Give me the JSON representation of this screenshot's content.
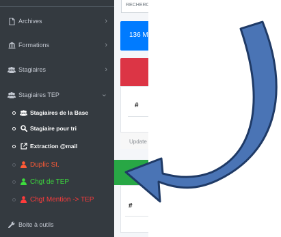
{
  "sidebar": {
    "items": [
      {
        "label": "Archives",
        "icon": "file-icon"
      },
      {
        "label": "Formations",
        "icon": "building-icon"
      },
      {
        "label": "Stagiaires",
        "icon": "users-icon"
      },
      {
        "label": "Stagiaires TEP",
        "icon": "users-icon"
      }
    ],
    "subitems": [
      {
        "label": "Stagiaires de la Base",
        "icon": "users-icon"
      },
      {
        "label": "Stagiaire pour tri",
        "icon": "search-icon"
      },
      {
        "label": "Extraction @mail",
        "icon": "external-link-icon"
      },
      {
        "label": "Duplic St.",
        "icon": "user-icon",
        "color": "#ff5a36"
      },
      {
        "label": "Chgt de TEP",
        "icon": "user-icon",
        "color": "#3ddc3d"
      },
      {
        "label": "Chgt Mention -> TEP",
        "icon": "user-icon",
        "color": "#ff3b3b"
      }
    ],
    "tools": {
      "label": "Boite à outils",
      "icon": "wrench-icon"
    }
  },
  "main": {
    "search_placeholder": "RECHERCHER",
    "blue_card_value": "136 M",
    "table_hash_1": "#",
    "update_label": "Update",
    "table_hash_2": "#"
  },
  "colors": {
    "sidebar_bg": "#343a40",
    "blue": "#007bff",
    "red": "#dc3545",
    "green": "#28a745",
    "arrow_fill": "#4a74b5",
    "arrow_stroke": "#1f3a66"
  }
}
